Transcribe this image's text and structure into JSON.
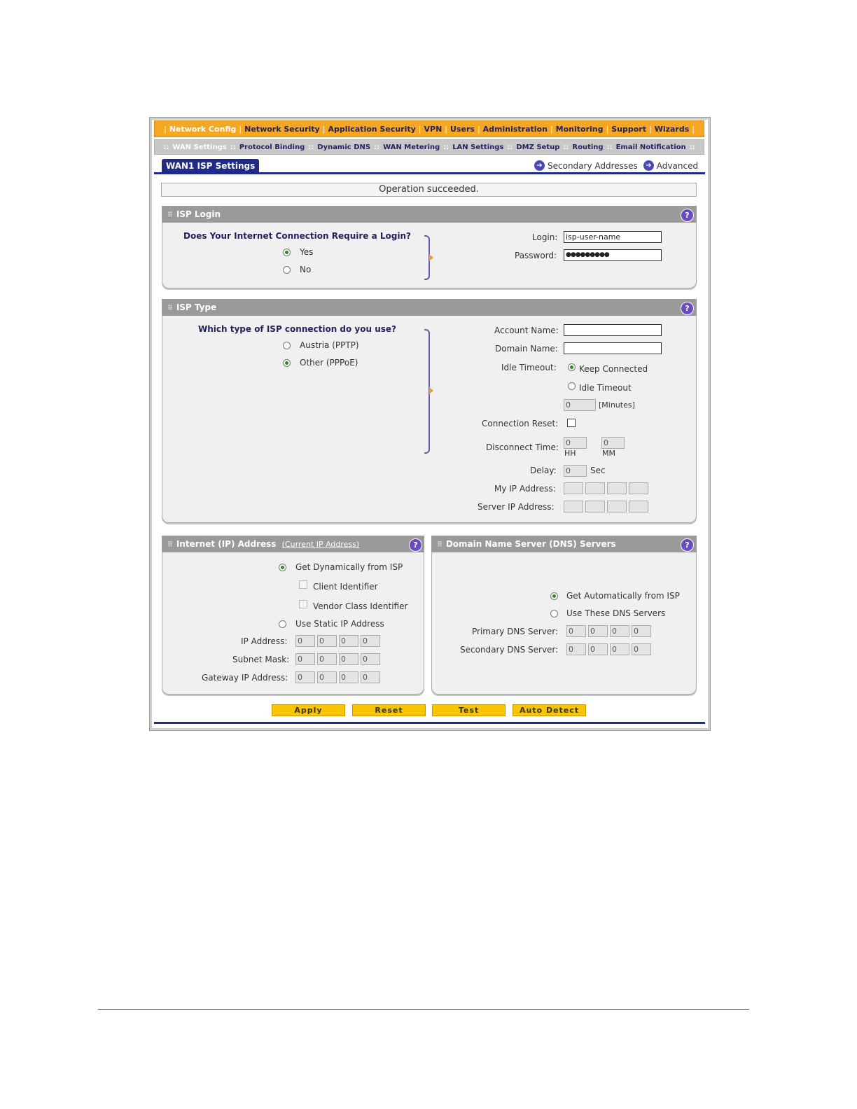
{
  "top_nav": [
    "Network Config",
    "Network Security",
    "Application Security",
    "VPN",
    "Users",
    "Administration",
    "Monitoring",
    "Support",
    "Wizards"
  ],
  "sub_nav": [
    "WAN Settings",
    "Protocol Binding",
    "Dynamic DNS",
    "WAN Metering",
    "LAN Settings",
    "DMZ Setup",
    "Routing",
    "Email Notification"
  ],
  "tab_label": "WAN1 ISP Settings",
  "links": {
    "secondary": "Secondary Addresses",
    "advanced": "Advanced"
  },
  "status_message": "Operation succeeded.",
  "isp_login": {
    "title": "ISP Login",
    "question": "Does Your Internet Connection Require a Login?",
    "yes": "Yes",
    "no": "No",
    "login_label": "Login:",
    "login_value": "isp-user-name",
    "password_label": "Password:",
    "password_value": "●●●●●●●●●"
  },
  "isp_type": {
    "title": "ISP Type",
    "question": "Which type of ISP connection do you use?",
    "austria": "Austria (PPTP)",
    "other": "Other (PPPoE)",
    "account_name_label": "Account Name:",
    "domain_name_label": "Domain Name:",
    "idle_timeout_label": "Idle Timeout:",
    "keep_connected": "Keep Connected",
    "idle_timeout_option": "Idle Timeout",
    "idle_minutes_value": "0",
    "minutes_unit": "[Minutes]",
    "connection_reset_label": "Connection Reset:",
    "disconnect_time_label": "Disconnect Time:",
    "disconnect_hh": "0",
    "disconnect_mm": "0",
    "hh": "HH",
    "mm": "MM",
    "delay_label": "Delay:",
    "delay_value": "0",
    "sec": "Sec",
    "my_ip_label": "My IP Address:",
    "server_ip_label": "Server IP Address:"
  },
  "internet_ip": {
    "title": "Internet (IP) Address",
    "current_link": "(Current IP Address)",
    "dynamic": "Get Dynamically from ISP",
    "client_identifier": "Client Identifier",
    "vendor_class": "Vendor Class Identifier",
    "static": "Use Static IP Address",
    "ip_label": "IP Address:",
    "subnet_label": "Subnet Mask:",
    "gateway_label": "Gateway IP Address:",
    "octet": "0"
  },
  "dns": {
    "title": "Domain Name Server (DNS) Servers",
    "auto": "Get Automatically from ISP",
    "these": "Use These DNS Servers",
    "primary_label": "Primary DNS Server:",
    "secondary_label": "Secondary DNS Server:",
    "octet": "0"
  },
  "buttons": {
    "apply": "Apply",
    "reset": "Reset",
    "test": "Test",
    "auto_detect": "Auto Detect"
  }
}
